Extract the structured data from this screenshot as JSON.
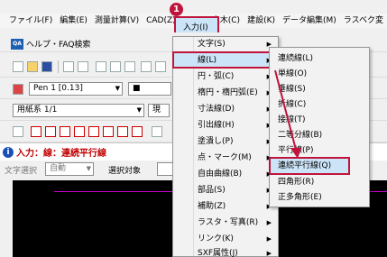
{
  "menubar": {
    "items": [
      "ファイル(F)",
      "編集(E)",
      "測量計算(V)",
      "CAD(Z)",
      "入力(I)",
      "土木(C)",
      "建設(K)",
      "データ編集(M)",
      "ラスベク変"
    ]
  },
  "faq": {
    "icon": "QA",
    "label": "ヘルプ・FAQ検索"
  },
  "toolbar": {
    "pen_label": "Pen 1 [0.13]",
    "paper_label": "用紙系 1/1",
    "current_prefix": "現"
  },
  "status": {
    "text": "入力：線：連続平行線"
  },
  "options": {
    "text_select_label": "文字選択",
    "text_select_value": "自動",
    "target_label": "選択対象"
  },
  "menu1": {
    "items": [
      {
        "label": "文字(S)",
        "sub": true
      },
      {
        "label": "線(L)",
        "sub": true
      },
      {
        "label": "円・弧(C)",
        "sub": true
      },
      {
        "label": "楕円・楕円弧(E)",
        "sub": true
      },
      {
        "label": "寸法線(D)",
        "sub": true
      },
      {
        "label": "引出線(H)",
        "sub": true
      },
      {
        "label": "塗潰し(P)",
        "sub": true
      },
      {
        "label": "点・マーク(M)",
        "sub": true
      },
      {
        "label": "自由曲線(B)",
        "sub": true
      },
      {
        "label": "部品(S)",
        "sub": true
      },
      {
        "label": "補助(Z)",
        "sub": true
      },
      {
        "label": "ラスタ・写真(R)",
        "sub": true
      },
      {
        "label": "リンク(K)",
        "sub": true
      },
      {
        "label": "SXF属性(J)",
        "sub": true
      }
    ]
  },
  "menu2": {
    "items": [
      {
        "label": "連続線(L)"
      },
      {
        "label": "単線(O)"
      },
      {
        "label": "垂線(S)"
      },
      {
        "label": "折線(C)"
      },
      {
        "label": "接線(T)"
      },
      {
        "label": "二等分線(B)"
      },
      {
        "label": "平行線(P)"
      },
      {
        "label": "連続平行線(Q)"
      },
      {
        "label": "四角形(R)"
      },
      {
        "label": "正多角形(E)"
      }
    ]
  },
  "badge": "1",
  "colors": {
    "accent": "#c0143c",
    "highlight": "#cce4f7",
    "status_text": "#c00000"
  }
}
